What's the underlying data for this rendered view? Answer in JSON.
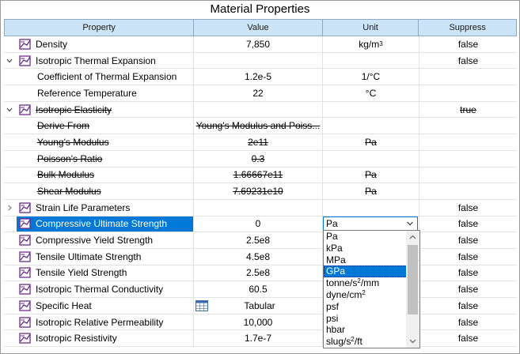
{
  "title": "Material Properties",
  "columns": {
    "property": "Property",
    "value": "Value",
    "unit": "Unit",
    "suppress": "Suppress"
  },
  "rows": [
    {
      "property": "Density",
      "value": "7,850",
      "unit": "kg/m",
      "unit_sup": "3",
      "suppress": "false"
    },
    {
      "property": "Isotropic Thermal Expansion",
      "value": "",
      "unit": "",
      "suppress": "false"
    },
    {
      "property": "Coefficient of Thermal Expansion",
      "value": "1.2e-5",
      "unit": "1/°C",
      "suppress": ""
    },
    {
      "property": "Reference Temperature",
      "value": "22",
      "unit": "°C",
      "suppress": ""
    },
    {
      "property": "Isotropic Elasticity",
      "value": "",
      "unit": "",
      "suppress": "true"
    },
    {
      "property": "Derive From",
      "value": "Young's Modulus and Poiss...",
      "unit": "",
      "suppress": ""
    },
    {
      "property": "Young's Modulus",
      "value": "2e11",
      "unit": "Pa",
      "suppress": ""
    },
    {
      "property": "Poisson's Ratio",
      "value": "0.3",
      "unit": "",
      "suppress": ""
    },
    {
      "property": "Bulk Modulus",
      "value": "1.66667e11",
      "unit": "Pa",
      "suppress": ""
    },
    {
      "property": "Shear Modulus",
      "value": "7.69231e10",
      "unit": "Pa",
      "suppress": ""
    },
    {
      "property": "Strain Life Parameters",
      "value": "",
      "unit": "",
      "suppress": "false"
    },
    {
      "property": "Compressive Ultimate Strength",
      "value": "0",
      "unit": "Pa",
      "suppress": "false"
    },
    {
      "property": "Compressive Yield Strength",
      "value": "2.5e8",
      "unit": "",
      "suppress": "false"
    },
    {
      "property": "Tensile Ultimate Strength",
      "value": "4.5e8",
      "unit": "",
      "suppress": "false"
    },
    {
      "property": "Tensile Yield Strength",
      "value": "2.5e8",
      "unit": "",
      "suppress": "false"
    },
    {
      "property": "Isotropic Thermal Conductivity",
      "value": "60.5",
      "unit": "",
      "suppress": "false"
    },
    {
      "property": "Specific Heat",
      "value": "Tabular",
      "unit": "",
      "suppress": "false"
    },
    {
      "property": "Isotropic Relative Permeability",
      "value": "10,000",
      "unit": "",
      "suppress": "false"
    },
    {
      "property": "Isotropic Resistivity",
      "value": "1.7e-7",
      "unit": "",
      "suppress": "false"
    }
  ],
  "unit_dropdown": {
    "selected": "GPa",
    "options": [
      {
        "base": "Pa",
        "sup": "",
        "tail": ""
      },
      {
        "base": "kPa",
        "sup": "",
        "tail": ""
      },
      {
        "base": "MPa",
        "sup": "",
        "tail": ""
      },
      {
        "base": "GPa",
        "sup": "",
        "tail": ""
      },
      {
        "base": "tonne/s",
        "sup": "2",
        "tail": "/mm"
      },
      {
        "base": "dyne/cm",
        "sup": "2",
        "tail": ""
      },
      {
        "base": "psf",
        "sup": "",
        "tail": ""
      },
      {
        "base": "psi",
        "sup": "",
        "tail": ""
      },
      {
        "base": "hbar",
        "sup": "",
        "tail": ""
      },
      {
        "base": "slug/s",
        "sup": "2",
        "tail": "/ft"
      }
    ]
  },
  "colors": {
    "header_bg": "#cce4f7",
    "selection": "#0078d7",
    "icon_purple": "#6a2c91"
  }
}
